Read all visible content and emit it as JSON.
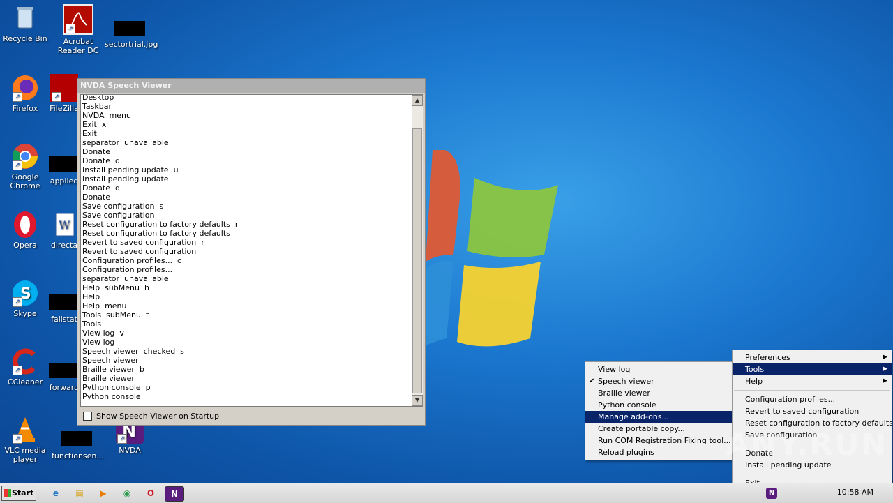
{
  "desktop": {
    "icons": [
      {
        "label": "Recycle Bin",
        "icon": "recycle-bin-icon"
      },
      {
        "label": "Acrobat Reader DC",
        "icon": "acrobat-icon"
      },
      {
        "label": "sectortrial.jpg",
        "icon": "image-file-icon"
      },
      {
        "label": "Firefox",
        "icon": "firefox-icon"
      },
      {
        "label": "FileZilla",
        "icon": "filezilla-icon"
      },
      {
        "label": "Google Chrome",
        "icon": "chrome-icon"
      },
      {
        "label": "applied",
        "icon": "file-icon"
      },
      {
        "label": "Opera",
        "icon": "opera-icon"
      },
      {
        "label": "directa",
        "icon": "word-doc-icon"
      },
      {
        "label": "Skype",
        "icon": "skype-icon"
      },
      {
        "label": "fallstat",
        "icon": "file-icon"
      },
      {
        "label": "CCleaner",
        "icon": "ccleaner-icon"
      },
      {
        "label": "forward",
        "icon": "file-icon"
      },
      {
        "label": "VLC media player",
        "icon": "vlc-icon"
      },
      {
        "label": "functionsen...",
        "icon": "file-icon"
      },
      {
        "label": "NVDA",
        "icon": "nvda-icon"
      }
    ]
  },
  "speech_viewer": {
    "title": "NVDA Speech Viewer",
    "lines": [
      "Desktop",
      "Taskbar",
      "NVDA  menu",
      "Exit  x",
      "Exit",
      "separator  unavailable",
      "Donate",
      "Donate  d",
      "Install pending update  u",
      "Install pending update",
      "Donate  d",
      "Donate",
      "Save configuration  s",
      "Save configuration",
      "Reset configuration to factory defaults  r",
      "Reset configuration to factory defaults",
      "Revert to saved configuration  r",
      "Revert to saved configuration",
      "Configuration profiles...  c",
      "Configuration profiles...",
      "separator  unavailable",
      "Help  subMenu  h",
      "Help",
      "Help  menu",
      "Tools  subMenu  t",
      "Tools",
      "View log  v",
      "View log",
      "Speech viewer  checked  s",
      "Speech viewer",
      "Braille viewer  b",
      "Braille viewer",
      "Python console  p",
      "Python console"
    ],
    "checkbox_label": "Show Speech Viewer on Startup"
  },
  "main_menu": {
    "items": [
      {
        "label": "Preferences",
        "submenu": true
      },
      {
        "label": "Tools",
        "submenu": true,
        "highlighted": true
      },
      {
        "label": "Help",
        "submenu": true
      },
      {
        "separator": true
      },
      {
        "label": "Configuration profiles..."
      },
      {
        "label": "Revert to saved configuration"
      },
      {
        "label": "Reset configuration to factory defaults"
      },
      {
        "label": "Save configuration"
      },
      {
        "separator": true
      },
      {
        "label": "Donate"
      },
      {
        "label": "Install pending update"
      },
      {
        "separator": true
      },
      {
        "label": "Exit"
      }
    ]
  },
  "tools_menu": {
    "items": [
      {
        "label": "View log"
      },
      {
        "label": "Speech viewer",
        "checked": true
      },
      {
        "label": "Braille viewer"
      },
      {
        "label": "Python console"
      },
      {
        "label": "Manage add-ons...",
        "highlighted": true
      },
      {
        "label": "Create portable copy..."
      },
      {
        "label": "Run COM Registration Fixing tool..."
      },
      {
        "label": "Reload plugins"
      }
    ]
  },
  "taskbar": {
    "start_label": "Start",
    "clock": "10:58 AM",
    "pinned": [
      "ie-icon",
      "explorer-icon",
      "media-player-icon",
      "chrome-icon",
      "opera-icon",
      "nvda-icon"
    ]
  },
  "watermark": "ANY.RUN"
}
